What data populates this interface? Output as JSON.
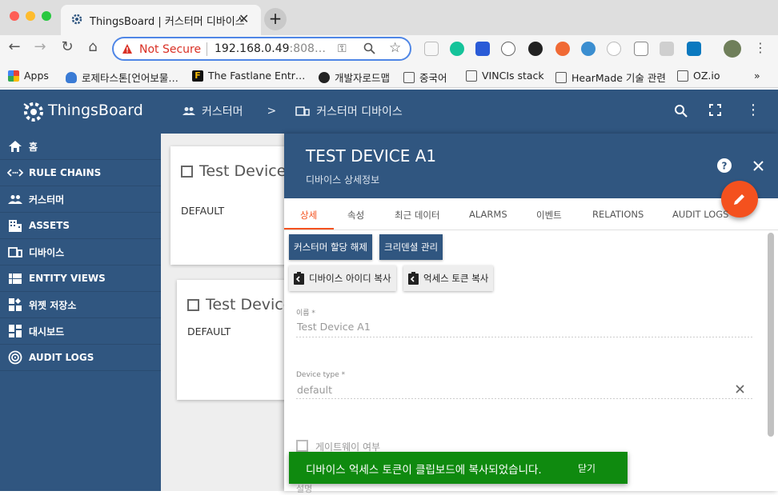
{
  "browser": {
    "tab_title": "ThingsBoard | 커스터머 디바이스",
    "not_secure": "Not Secure",
    "url_host": "192.168.0.49",
    "url_rest": ":808…",
    "bookmarks": [
      {
        "label": "Apps"
      },
      {
        "label": "로제타스톤[언어보물…"
      },
      {
        "label": "The Fastlane Entr…"
      },
      {
        "label": "개발자로드맵"
      },
      {
        "label": "중국어"
      },
      {
        "label": "VINCIs stack"
      },
      {
        "label": "HearMade 기술 관련"
      },
      {
        "label": "OZ.io"
      }
    ],
    "bookmarks_more": "»"
  },
  "app": {
    "brand": "ThingsBoard",
    "breadcrumb": [
      "커스터머",
      "커스터머 디바이스"
    ],
    "breadcrumb_sep": ">"
  },
  "sidebar": {
    "items": [
      {
        "label": "홈",
        "icon": "home-icon"
      },
      {
        "label": "RULE CHAINS",
        "icon": "rule-chains-icon"
      },
      {
        "label": "커스터머",
        "icon": "customers-icon"
      },
      {
        "label": "ASSETS",
        "icon": "assets-icon"
      },
      {
        "label": "디바이스",
        "icon": "devices-icon"
      },
      {
        "label": "ENTITY VIEWS",
        "icon": "entity-views-icon"
      },
      {
        "label": "위젯 저장소",
        "icon": "widgets-icon"
      },
      {
        "label": "대시보드",
        "icon": "dashboards-icon"
      },
      {
        "label": "AUDIT LOGS",
        "icon": "audit-logs-icon"
      }
    ]
  },
  "cards": [
    {
      "title": "Test Device",
      "type": "DEFAULT"
    },
    {
      "title": "Test Device",
      "type": "DEFAULT"
    }
  ],
  "panel": {
    "title": "TEST DEVICE A1",
    "subtitle": "디바이스 상세정보",
    "tabs": [
      "상세",
      "속성",
      "최근 데이터",
      "ALARMS",
      "이벤트",
      "RELATIONS",
      "AUDIT LOGS"
    ],
    "buttons": {
      "unassign": "커스터머 할당 해제",
      "credentials": "크리덴셜 관리",
      "copy_id": "디바이스 아이디 복사",
      "copy_token": "억세스 토큰 복사"
    },
    "fields": {
      "name_label": "이름 *",
      "name_value": "Test Device A1",
      "type_label": "Device type *",
      "type_value": "default",
      "gateway_label": "게이트웨이 여부",
      "desc_label": "설명"
    }
  },
  "snackbar": {
    "message": "디바이스 억세스 토큰이 클립보드에 복사되었습니다.",
    "close": "닫기"
  },
  "colors": {
    "primary": "#305680",
    "accent": "#f4511e",
    "snackbar": "#0f8a0f"
  }
}
